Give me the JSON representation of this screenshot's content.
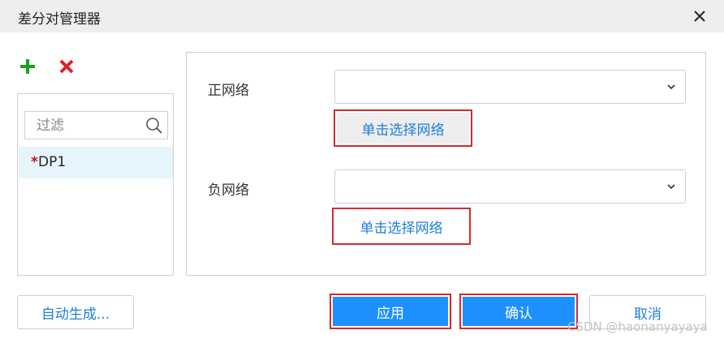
{
  "window": {
    "title": "差分对管理器",
    "close_icon": "close-icon"
  },
  "toolbar": {
    "add_icon": "plus-icon",
    "delete_icon": "x-icon",
    "add_color": "#1aa31a",
    "delete_color": "#e0202a"
  },
  "list": {
    "filter_placeholder": "过滤",
    "filter_value": "",
    "search_icon": "search-icon",
    "items": [
      {
        "marker": "*",
        "label": "DP1",
        "selected": true
      }
    ]
  },
  "form": {
    "positive_label": "正网络",
    "positive_value": "",
    "positive_pick_label": "单击选择网络",
    "negative_label": "负网络",
    "negative_value": "",
    "negative_pick_label": "单击选择网络",
    "dropdown_icon": "chevron-down-icon"
  },
  "footer": {
    "auto_generate_label": "自动生成...",
    "apply_label": "应用",
    "ok_label": "确认",
    "cancel_label": "取消"
  },
  "watermark": "CSDN @haonanyayaya",
  "colors": {
    "accent": "#1e90ff",
    "link": "#1e7fd9",
    "highlight_border": "#d7282f",
    "selected_row": "#e6f4fc"
  }
}
